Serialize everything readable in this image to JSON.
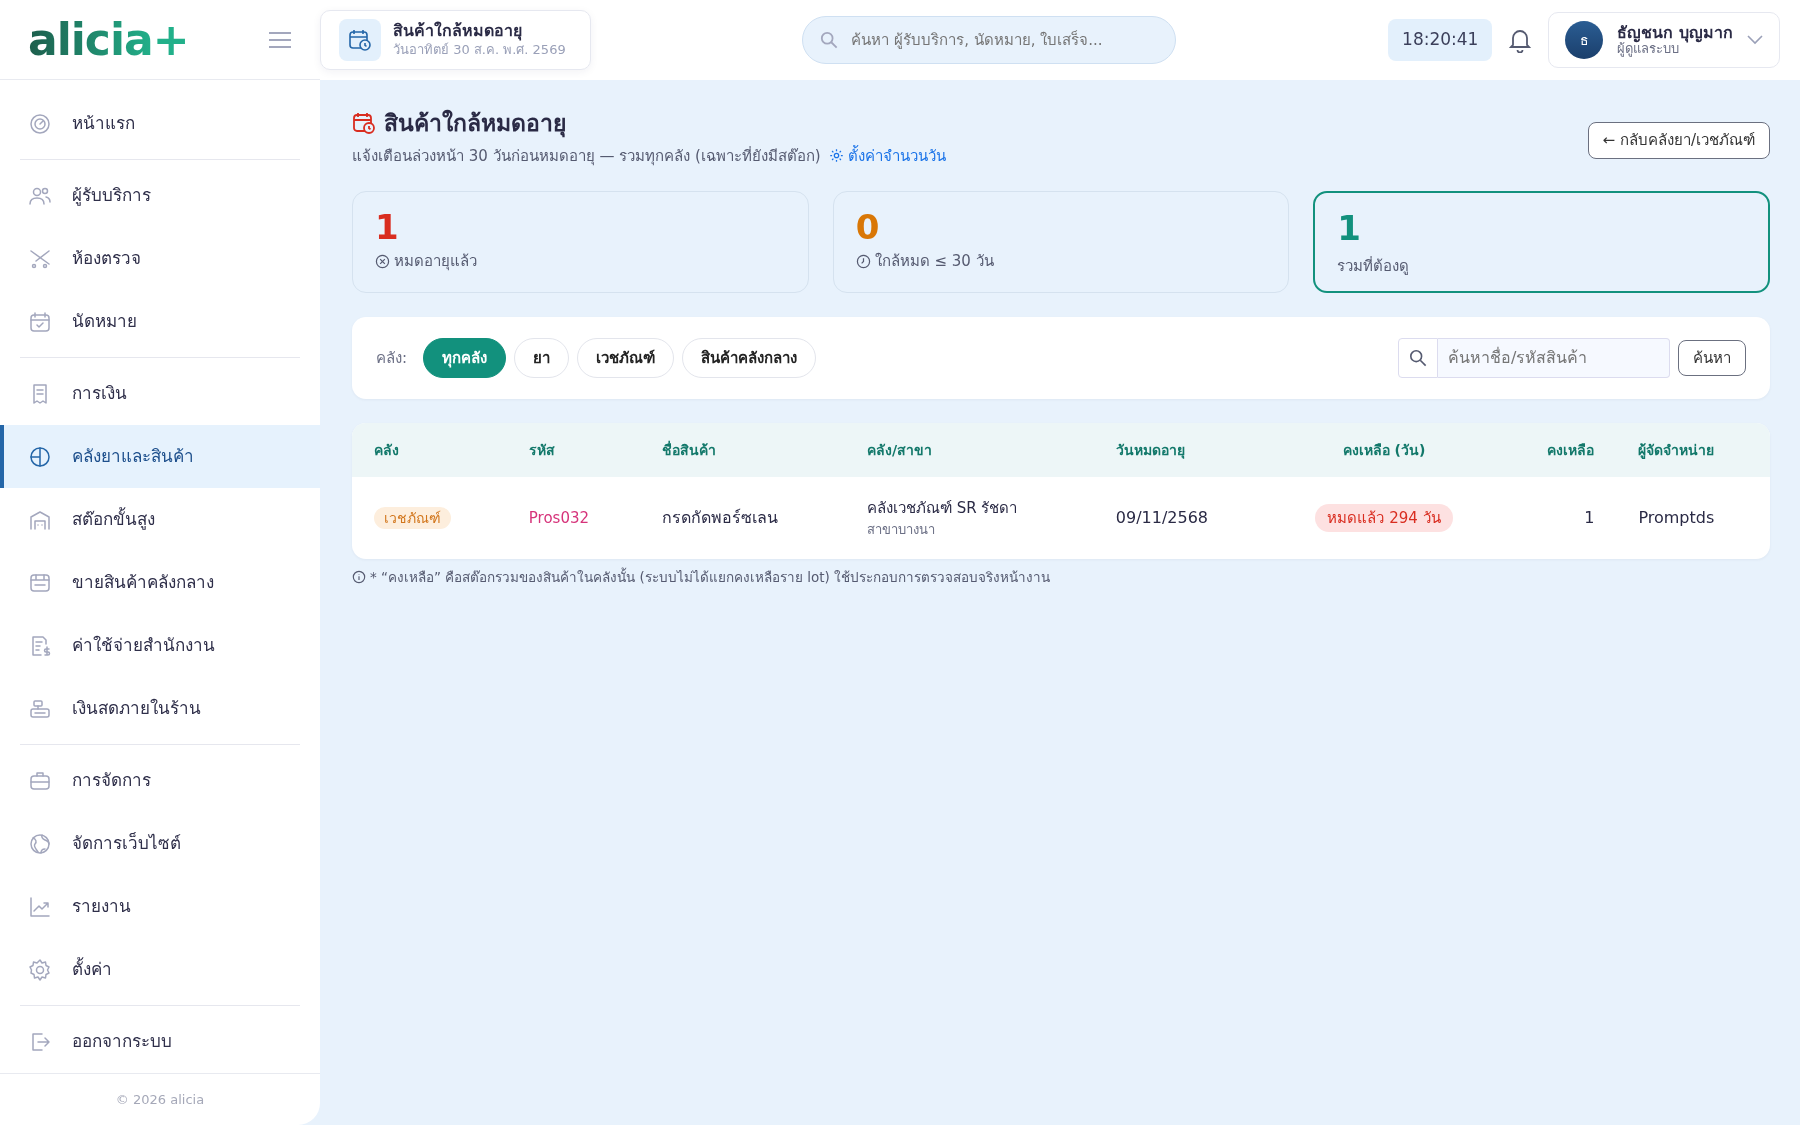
{
  "brand": {
    "logo": "alicia",
    "logo_mark": "+"
  },
  "sidebar": {
    "groups": [
      {
        "items": [
          {
            "label": "หน้าแรก",
            "selected": false
          }
        ]
      },
      {
        "items": [
          {
            "label": "ผู้รับบริการ",
            "selected": false
          },
          {
            "label": "ห้องตรวจ",
            "selected": false
          },
          {
            "label": "นัดหมาย",
            "selected": false
          }
        ]
      },
      {
        "items": [
          {
            "label": "การเงิน",
            "selected": false
          },
          {
            "label": "คลังยาและสินค้า",
            "selected": true
          },
          {
            "label": "สต๊อกขั้นสูง",
            "selected": false
          },
          {
            "label": "ขายสินค้าคลังกลาง",
            "selected": false
          },
          {
            "label": "ค่าใช้จ่ายสำนักงาน",
            "selected": false
          },
          {
            "label": "เงินสดภายในร้าน",
            "selected": false
          }
        ]
      },
      {
        "items": [
          {
            "label": "การจัดการ",
            "selected": false
          },
          {
            "label": "จัดการเว็บไซต์",
            "selected": false
          },
          {
            "label": "รายงาน",
            "selected": false
          },
          {
            "label": "ตั้งค่า",
            "selected": false
          }
        ]
      },
      {
        "items": [
          {
            "label": "ออกจากระบบ",
            "selected": false
          }
        ]
      }
    ],
    "footer": "© 2026 alicia"
  },
  "topbar": {
    "page_title": "สินค้าใกล้หมดอายุ",
    "date": "วันอาทิตย์ 30 ส.ค. พ.ศ. 2569",
    "search": {
      "placeholder": "ค้นหา ผู้รับบริการ, นัดหมาย, ใบเสร็จ..."
    },
    "clock": "18:20:41",
    "user": {
      "initial": "ธ",
      "name": "ธัญชนก บุญมาก",
      "role": "ผู้ดูแลระบบ"
    }
  },
  "header": {
    "title": "สินค้าใกล้หมดอายุ",
    "subtitle": "แจ้งเตือนล่วงหน้า 30 วันก่อนหมดอายุ — รวมทุกคลัง (เฉพาะที่ยังมีสต๊อก)",
    "settings_link": "ตั้งค่าจำนวนวัน",
    "back_button": "← กลับคลังยา/เวชภัณฑ์"
  },
  "stats": [
    {
      "value": "1",
      "label": "หมดอายุแล้ว",
      "color": "#d92d20",
      "selected": false
    },
    {
      "value": "0",
      "label": "ใกล้หมด ≤ 30 วัน",
      "color": "#d97706",
      "selected": false
    },
    {
      "value": "1",
      "label": "รวมที่ต้องดู",
      "color": "#12917d",
      "selected": true
    }
  ],
  "filters": {
    "label": "คลัง:",
    "chips": [
      {
        "label": "ทุกคลัง",
        "selected": true
      },
      {
        "label": "ยา",
        "selected": false
      },
      {
        "label": "เวชภัณฑ์",
        "selected": false
      },
      {
        "label": "สินค้าคลังกลาง",
        "selected": false
      }
    ],
    "search": {
      "placeholder": "ค้นหาชื่อ/รหัสสินค้า"
    },
    "search_button": "ค้นหา"
  },
  "table": {
    "columns": [
      "คลัง",
      "รหัส",
      "ชื่อสินค้า",
      "คลัง/สาขา",
      "วันหมดอายุ",
      "คงเหลือ (วัน)",
      "คงเหลือ",
      "ผู้จัดจำหน่าย"
    ],
    "rows": [
      {
        "warehouse": "เวชภัณฑ์",
        "code": "Pros032",
        "name": "กรดกัดพอร์ซเลน",
        "store": "คลังเวชภัณฑ์ SR รัชดา",
        "branch": "สาขาบางนา",
        "expiry": "09/11/2568",
        "days_left": "หมดแล้ว 294 วัน",
        "qty": "1",
        "supplier": "Promptds"
      }
    ]
  },
  "footnote": "* “คงเหลือ” คือสต๊อกรวมของสินค้าในคลังนั้น (ระบบไม่ได้แยกคงเหลือราย lot) ใช้ประกอบการตรวจสอบจริงหน้างาน"
}
